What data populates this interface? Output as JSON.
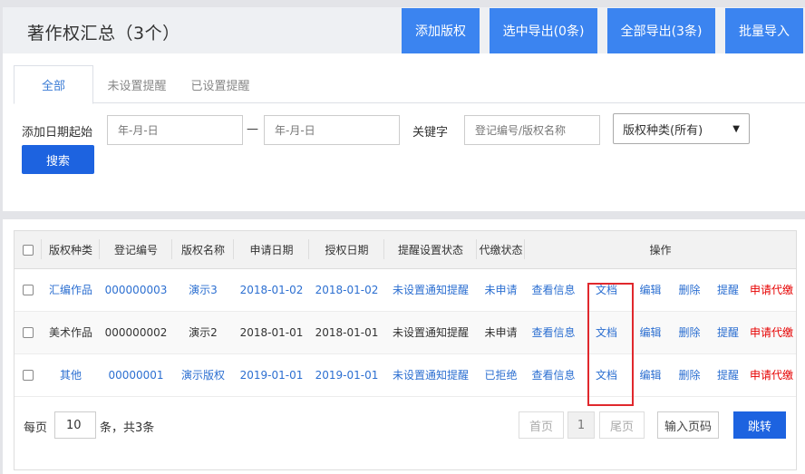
{
  "header": {
    "title": "著作权汇总（3个）",
    "buttons": [
      "添加版权",
      "选中导出(0条)",
      "全部导出(3条)",
      "批量导入"
    ]
  },
  "tabs": [
    "全部",
    "未设置提醒",
    "已设置提醒"
  ],
  "filters": {
    "date_label": "添加日期起始",
    "date_start_placeholder": "年-月-日",
    "date_sep": "—",
    "date_end_placeholder": "年-月-日",
    "keyword_label": "关键字",
    "keyword_placeholder": "登记编号/版权名称",
    "category_selected": "版权种类(所有)",
    "search_label": "搜索"
  },
  "table": {
    "columns": [
      "版权种类",
      "登记编号",
      "版权名称",
      "申请日期",
      "授权日期",
      "提醒设置状态",
      "代缴状态",
      "操作"
    ],
    "rows": [
      {
        "category": "汇编作品",
        "reg_no": "000000003",
        "name": "演示3",
        "apply_date": "2018-01-02",
        "grant_date": "2018-01-02",
        "reminder": "未设置通知提醒",
        "pay_status": "未申请"
      },
      {
        "category": "美术作品",
        "reg_no": "000000002",
        "name": "演示2",
        "apply_date": "2018-01-01",
        "grant_date": "2018-01-01",
        "reminder": "未设置通知提醒",
        "pay_status": "未申请"
      },
      {
        "category": "其他",
        "reg_no": "00000001",
        "name": "演示版权",
        "apply_date": "2019-01-01",
        "grant_date": "2019-01-01",
        "reminder": "未设置通知提醒",
        "pay_status": "已拒绝"
      }
    ],
    "actions": [
      "查看信息",
      "文档",
      "编辑",
      "删除",
      "提醒",
      "申请代缴"
    ]
  },
  "pagination": {
    "per_page_label": "每页",
    "per_page_value": "10",
    "total_text": "条，共3条",
    "first": "首页",
    "current": "1",
    "last": "尾页",
    "jump_placeholder": "输入页码",
    "jump_label": "跳转"
  },
  "colors": {
    "primary": "#3b84f0",
    "search": "#1d63e0",
    "link": "#2c6fd1",
    "danger": "#e60000",
    "highlight": "#e0282d"
  }
}
